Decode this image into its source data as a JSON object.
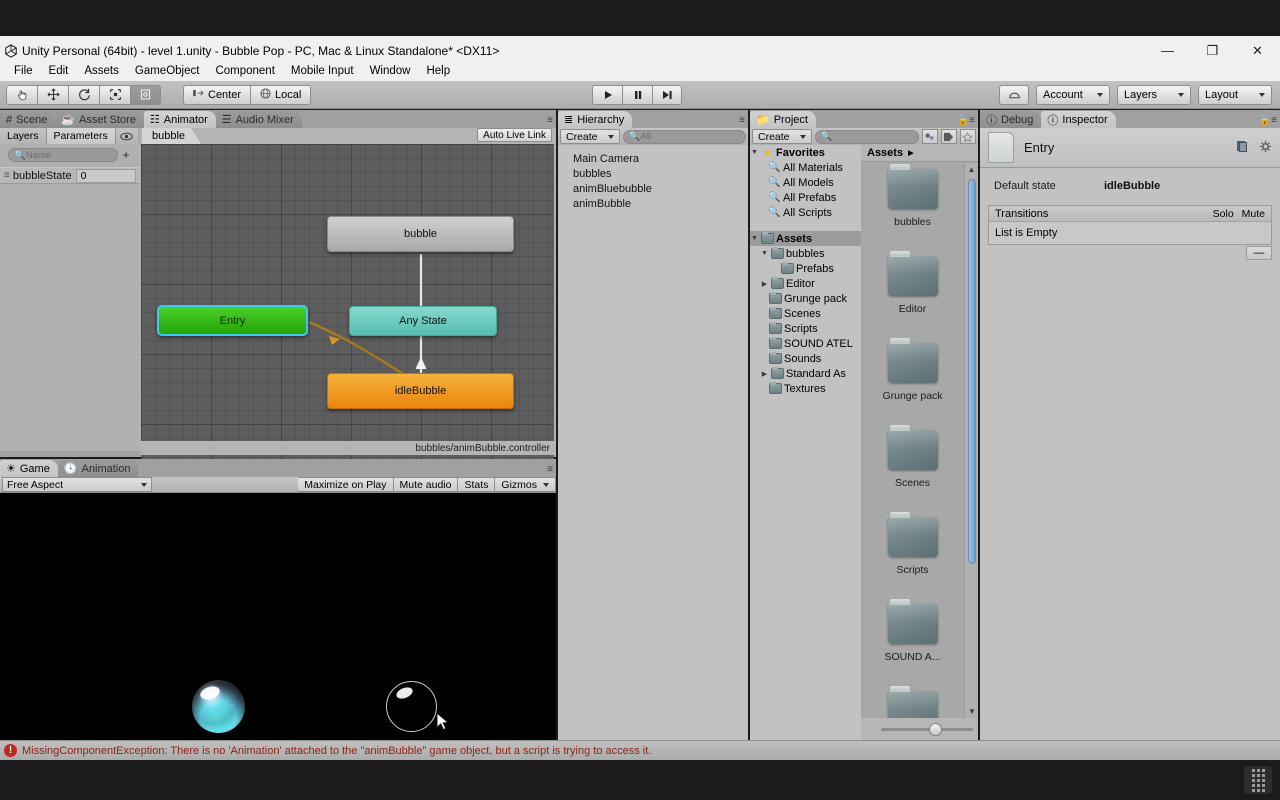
{
  "window": {
    "title": "Unity Personal (64bit) - level 1.unity - Bubble Pop - PC, Mac & Linux Standalone* <DX11>",
    "app_icon": "unity-icon",
    "minimize": "—",
    "maximize": "❐",
    "close": "✕"
  },
  "menubar": {
    "items": [
      "File",
      "Edit",
      "Assets",
      "GameObject",
      "Component",
      "Mobile Input",
      "Window",
      "Help"
    ]
  },
  "toolbar": {
    "tools": [
      {
        "name": "hand-tool",
        "glyph": "✋"
      },
      {
        "name": "move-tool",
        "glyph": "✥"
      },
      {
        "name": "rotate-tool",
        "glyph": "↻"
      },
      {
        "name": "scale-tool",
        "glyph": "⤢"
      },
      {
        "name": "rect-tool",
        "glyph": "▣"
      }
    ],
    "pivot_label": "Center",
    "space_label": "Local",
    "play": "▶",
    "pause": "‖",
    "step": "▶|",
    "cloud_label": "cloud-icon",
    "account_label": "Account",
    "layers_label": "Layers",
    "layout_label": "Layout"
  },
  "animator": {
    "tabs": [
      {
        "label": "Scene",
        "icon": "grid-icon",
        "active": false
      },
      {
        "label": "Asset Store",
        "icon": "store-icon",
        "active": false
      },
      {
        "label": "Animator",
        "icon": "animator-icon",
        "active": true
      },
      {
        "label": "Audio Mixer",
        "icon": "mixer-icon",
        "active": false
      }
    ],
    "subtabs": [
      {
        "label": "Layers",
        "active": false
      },
      {
        "label": "Parameters",
        "active": true
      }
    ],
    "eye_icon": "eye-icon",
    "breadcrumb": "bubble",
    "auto_live_link": "Auto Live Link",
    "search_placeholder": "Name",
    "add_param": "+",
    "parameters": [
      {
        "name": "bubbleState",
        "value": "0"
      }
    ],
    "footer_path": "bubbles/animBubble.controller",
    "nodes": [
      {
        "name": "bubble",
        "type": "state"
      },
      {
        "name": "Entry",
        "type": "entry"
      },
      {
        "name": "Any State",
        "type": "any"
      },
      {
        "name": "idleBubble",
        "type": "default"
      }
    ],
    "colors": {
      "entry": "#2da808",
      "any_state": "#6fcdc2",
      "default_state": "#ef9415",
      "normal_state": "#bcbcbc",
      "selection": "#38c8f0",
      "graph_bg": "#5d5d5d"
    }
  },
  "game": {
    "tabs": [
      {
        "label": "Game",
        "icon": "game-icon",
        "active": true
      },
      {
        "label": "Animation",
        "icon": "clock-icon",
        "active": false
      }
    ],
    "aspect": "Free Aspect",
    "buttons": [
      "Maximize on Play",
      "Mute audio",
      "Stats",
      "Gizmos"
    ]
  },
  "hierarchy": {
    "tab_label": "Hierarchy",
    "tab_icon": "hierarchy-icon",
    "create_label": "Create",
    "search_placeholder": "All",
    "items": [
      "Main Camera",
      "bubbles",
      "animBluebubble",
      "animBubble"
    ]
  },
  "project": {
    "tab_label": "Project",
    "tab_icon": "folder-icon",
    "create_label": "Create",
    "search_placeholder": "",
    "icon_buttons": [
      "favorites-filter-icon",
      "label-filter-icon",
      "star-filter-icon"
    ],
    "lock_icon": "lock-icon",
    "favorites": {
      "label": "Favorites",
      "items": [
        "All Materials",
        "All Models",
        "All Prefabs",
        "All Scripts"
      ]
    },
    "assets": {
      "label": "Assets",
      "tree": [
        {
          "label": "bubbles",
          "depth": 1,
          "arrow": "▼"
        },
        {
          "label": "Prefabs",
          "depth": 2,
          "arrow": ""
        },
        {
          "label": "Editor",
          "depth": 1,
          "arrow": "▶"
        },
        {
          "label": "Grunge pack",
          "depth": 1,
          "arrow": ""
        },
        {
          "label": "Scenes",
          "depth": 1,
          "arrow": ""
        },
        {
          "label": "Scripts",
          "depth": 1,
          "arrow": ""
        },
        {
          "label": "SOUND ATEL",
          "depth": 1,
          "arrow": ""
        },
        {
          "label": "Sounds",
          "depth": 1,
          "arrow": ""
        },
        {
          "label": "Standard As",
          "depth": 1,
          "arrow": "▶"
        },
        {
          "label": "Textures",
          "depth": 1,
          "arrow": ""
        }
      ]
    },
    "breadcrumb": "Assets",
    "grid_items": [
      "bubbles",
      "Editor",
      "Grunge pack",
      "Scenes",
      "Scripts",
      "SOUND A..."
    ]
  },
  "inspector": {
    "tabs": [
      {
        "label": "Debug",
        "icon": "info-icon",
        "active": false
      },
      {
        "label": "Inspector",
        "icon": "info-icon",
        "active": true
      }
    ],
    "lock_icon": "lock-icon",
    "menu_icon": "panel-menu-icon",
    "title": "Entry",
    "book_icon": "reference-icon",
    "gear_icon": "gear-icon",
    "default_state_label": "Default state",
    "default_state_value": "idleBubble",
    "transitions_label": "Transitions",
    "solo_label": "Solo",
    "mute_label": "Mute",
    "list_empty": "List is Empty",
    "remove_label": "—"
  },
  "statusbar": {
    "icon": "error-icon",
    "message": "MissingComponentException: There is no 'Animation' attached to the \"animBubble\" game object, but a script is trying to access it.",
    "color": "#8d2318"
  },
  "taskbar": {
    "tray_icon": "keyboard-icon"
  }
}
